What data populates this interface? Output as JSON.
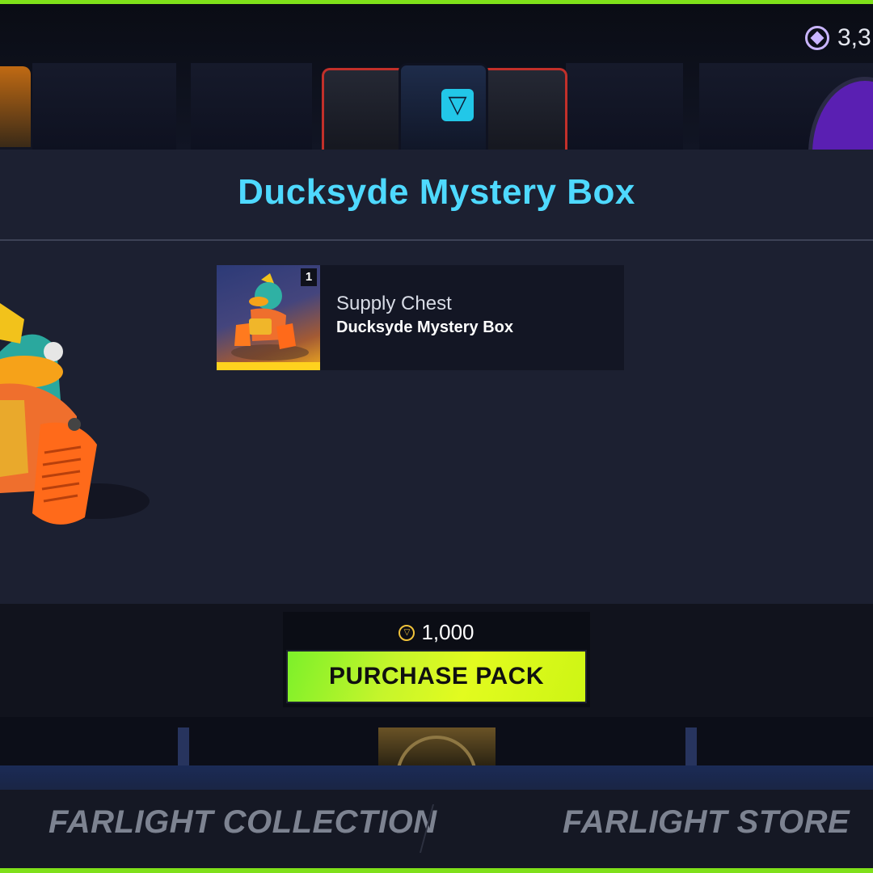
{
  "header": {
    "currency_icon": "farcoin-icon",
    "currency_amount": "3,3"
  },
  "modal": {
    "title": "Ducksyde Mystery Box",
    "items": [
      {
        "count": "1",
        "type": "Supply Chest",
        "name": "Ducksyde Mystery Box",
        "icon": "duck-chest-thumbnail"
      }
    ]
  },
  "purchase": {
    "price_icon": "diamond-coin-icon",
    "price": "1,000",
    "button_label": "PURCHASE PACK",
    "button_color": "#c6f52b"
  },
  "tabs": [
    {
      "label": "FARLIGHT COLLECTION"
    },
    {
      "label": "FARLIGHT STORE"
    }
  ],
  "colors": {
    "accent_title": "#4ed9ff",
    "frame_border": "#7fe01a",
    "modal_bg": "#1c2031"
  }
}
